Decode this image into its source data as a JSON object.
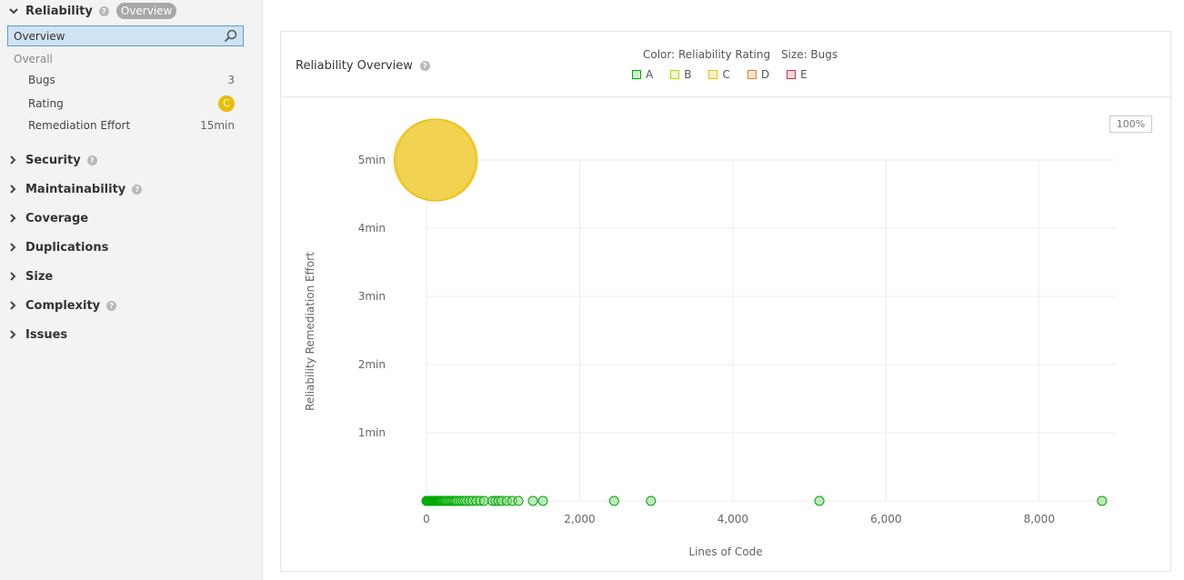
{
  "sidebar": {
    "domain_title": "Reliability",
    "domain_badge": "Overview",
    "search": {
      "value": "Overview",
      "placeholder": ""
    },
    "group_label": "Overall",
    "metrics": [
      {
        "label": "Bugs",
        "value": "3"
      },
      {
        "label": "Rating",
        "value": "C"
      },
      {
        "label": "Remediation Effort",
        "value": "15min"
      }
    ],
    "domains": [
      {
        "label": "Security",
        "help": true
      },
      {
        "label": "Maintainability",
        "help": true
      },
      {
        "label": "Coverage",
        "help": false
      },
      {
        "label": "Duplications",
        "help": false
      },
      {
        "label": "Size",
        "help": false
      },
      {
        "label": "Complexity",
        "help": true
      },
      {
        "label": "Issues",
        "help": false
      }
    ]
  },
  "panel": {
    "title": "Reliability Overview",
    "color_caption": "Color: Reliability Rating",
    "size_caption": "Size: Bugs",
    "legend": [
      {
        "label": "A",
        "color": "#00aa00",
        "fill": "#b0d513"
      },
      {
        "label": "B",
        "color": "#b0d513",
        "fill": "#b0d513"
      },
      {
        "label": "C",
        "color": "#eabe06",
        "fill": "#eabe06"
      },
      {
        "label": "D",
        "color": "#ed7d20",
        "fill": "#ed7d20"
      },
      {
        "label": "E",
        "color": "#d4333f",
        "fill": "#d4333f"
      }
    ],
    "zoom": "100%"
  },
  "colors": {
    "A": "#00aa00",
    "C": "#eabe06",
    "accent": "#5b9bd5"
  },
  "chart_data": {
    "type": "scatter",
    "xlabel": "Lines of Code",
    "ylabel": "Reliability Remediation Effort",
    "xlim": [
      0,
      9000
    ],
    "ylim": [
      0,
      5
    ],
    "x_ticks": [
      0,
      2000,
      4000,
      6000,
      8000
    ],
    "x_tick_labels": [
      "0",
      "2,000",
      "4,000",
      "6,000",
      "8,000"
    ],
    "y_ticks": [
      1,
      2,
      3,
      4,
      5
    ],
    "y_tick_labels": [
      "1min",
      "2min",
      "3min",
      "4min",
      "5min"
    ],
    "grid": true,
    "series": [
      {
        "rating": "A",
        "bugs": 0,
        "points": [
          [
            0,
            0
          ],
          [
            10,
            0
          ],
          [
            20,
            0
          ],
          [
            30,
            0
          ],
          [
            40,
            0
          ],
          [
            50,
            0
          ],
          [
            60,
            0
          ],
          [
            70,
            0
          ],
          [
            80,
            0
          ],
          [
            90,
            0
          ],
          [
            100,
            0
          ],
          [
            110,
            0
          ],
          [
            120,
            0
          ],
          [
            130,
            0
          ],
          [
            140,
            0
          ],
          [
            150,
            0
          ],
          [
            160,
            0
          ],
          [
            170,
            0
          ],
          [
            180,
            0
          ],
          [
            190,
            0
          ],
          [
            200,
            0
          ],
          [
            215,
            0
          ],
          [
            230,
            0
          ],
          [
            245,
            0
          ],
          [
            260,
            0
          ],
          [
            280,
            0
          ],
          [
            300,
            0
          ],
          [
            320,
            0
          ],
          [
            340,
            0
          ],
          [
            360,
            0
          ],
          [
            380,
            0
          ],
          [
            400,
            0
          ],
          [
            430,
            0
          ],
          [
            460,
            0
          ],
          [
            490,
            0
          ],
          [
            520,
            0
          ],
          [
            560,
            0
          ],
          [
            600,
            0
          ],
          [
            650,
            0
          ],
          [
            700,
            0
          ],
          [
            750,
            0
          ],
          [
            860,
            0
          ],
          [
            900,
            0
          ],
          [
            940,
            0
          ],
          [
            980,
            0
          ],
          [
            1050,
            0
          ],
          [
            1120,
            0
          ],
          [
            1200,
            0
          ],
          [
            1390,
            0
          ],
          [
            1520,
            0
          ],
          [
            2450,
            0
          ],
          [
            2930,
            0
          ],
          [
            5130,
            0
          ],
          [
            8820,
            0
          ]
        ]
      },
      {
        "rating": "C",
        "bugs": 2,
        "points": [
          [
            110,
            5
          ],
          [
            130,
            5
          ]
        ]
      }
    ]
  }
}
